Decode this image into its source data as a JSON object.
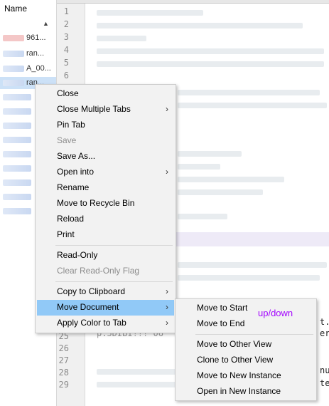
{
  "file_panel": {
    "title": "Name",
    "sort_icon": "▲",
    "rows": [
      {
        "text": "961..."
      },
      {
        "text": "ran..."
      },
      {
        "text": "A_00..."
      },
      {
        "text": "ran..."
      }
    ]
  },
  "editor": {
    "line_numbers_top": [
      "1",
      "2",
      "3",
      "4",
      "5",
      "6"
    ],
    "line_numbers_bottom": [
      "25",
      "26",
      "27",
      "28",
      "29"
    ],
    "fragments": [
      {
        "text": "t."
      },
      {
        "text": "er"
      },
      {
        "text": "p:5DIBI!!! 06"
      },
      {
        "text": "nu"
      },
      {
        "text": "te"
      }
    ]
  },
  "context_menu": {
    "items": [
      {
        "label": "Close",
        "disabled": false,
        "submenu": false
      },
      {
        "label": "Close Multiple Tabs",
        "disabled": false,
        "submenu": true
      },
      {
        "label": "Pin Tab",
        "disabled": false,
        "submenu": false
      },
      {
        "label": "Save",
        "disabled": true,
        "submenu": false
      },
      {
        "label": "Save As...",
        "disabled": false,
        "submenu": false
      },
      {
        "label": "Open into",
        "disabled": false,
        "submenu": true
      },
      {
        "label": "Rename",
        "disabled": false,
        "submenu": false
      },
      {
        "label": "Move to Recycle Bin",
        "disabled": false,
        "submenu": false
      },
      {
        "label": "Reload",
        "disabled": false,
        "submenu": false
      },
      {
        "label": "Print",
        "disabled": false,
        "submenu": false
      },
      {
        "label": "Read-Only",
        "disabled": false,
        "submenu": false
      },
      {
        "label": "Clear Read-Only Flag",
        "disabled": true,
        "submenu": false
      },
      {
        "label": "Copy to Clipboard",
        "disabled": false,
        "submenu": true
      },
      {
        "label": "Move Document",
        "disabled": false,
        "submenu": true,
        "active": true
      },
      {
        "label": "Apply Color to Tab",
        "disabled": false,
        "submenu": true
      }
    ],
    "submenu_arrow": "›"
  },
  "submenu": {
    "items": [
      {
        "label": "Move to Start"
      },
      {
        "label": "Move to End"
      },
      {
        "label": "Move to Other View"
      },
      {
        "label": "Clone to Other View"
      },
      {
        "label": "Move to New Instance"
      },
      {
        "label": "Open in New Instance"
      }
    ]
  },
  "annotation": {
    "text": "up/down",
    "color": "#a200ff"
  },
  "colors": {
    "highlight": "#91c9f7",
    "menu_bg": "#f2f2f2",
    "gutter_bg": "#f0f0f0"
  }
}
